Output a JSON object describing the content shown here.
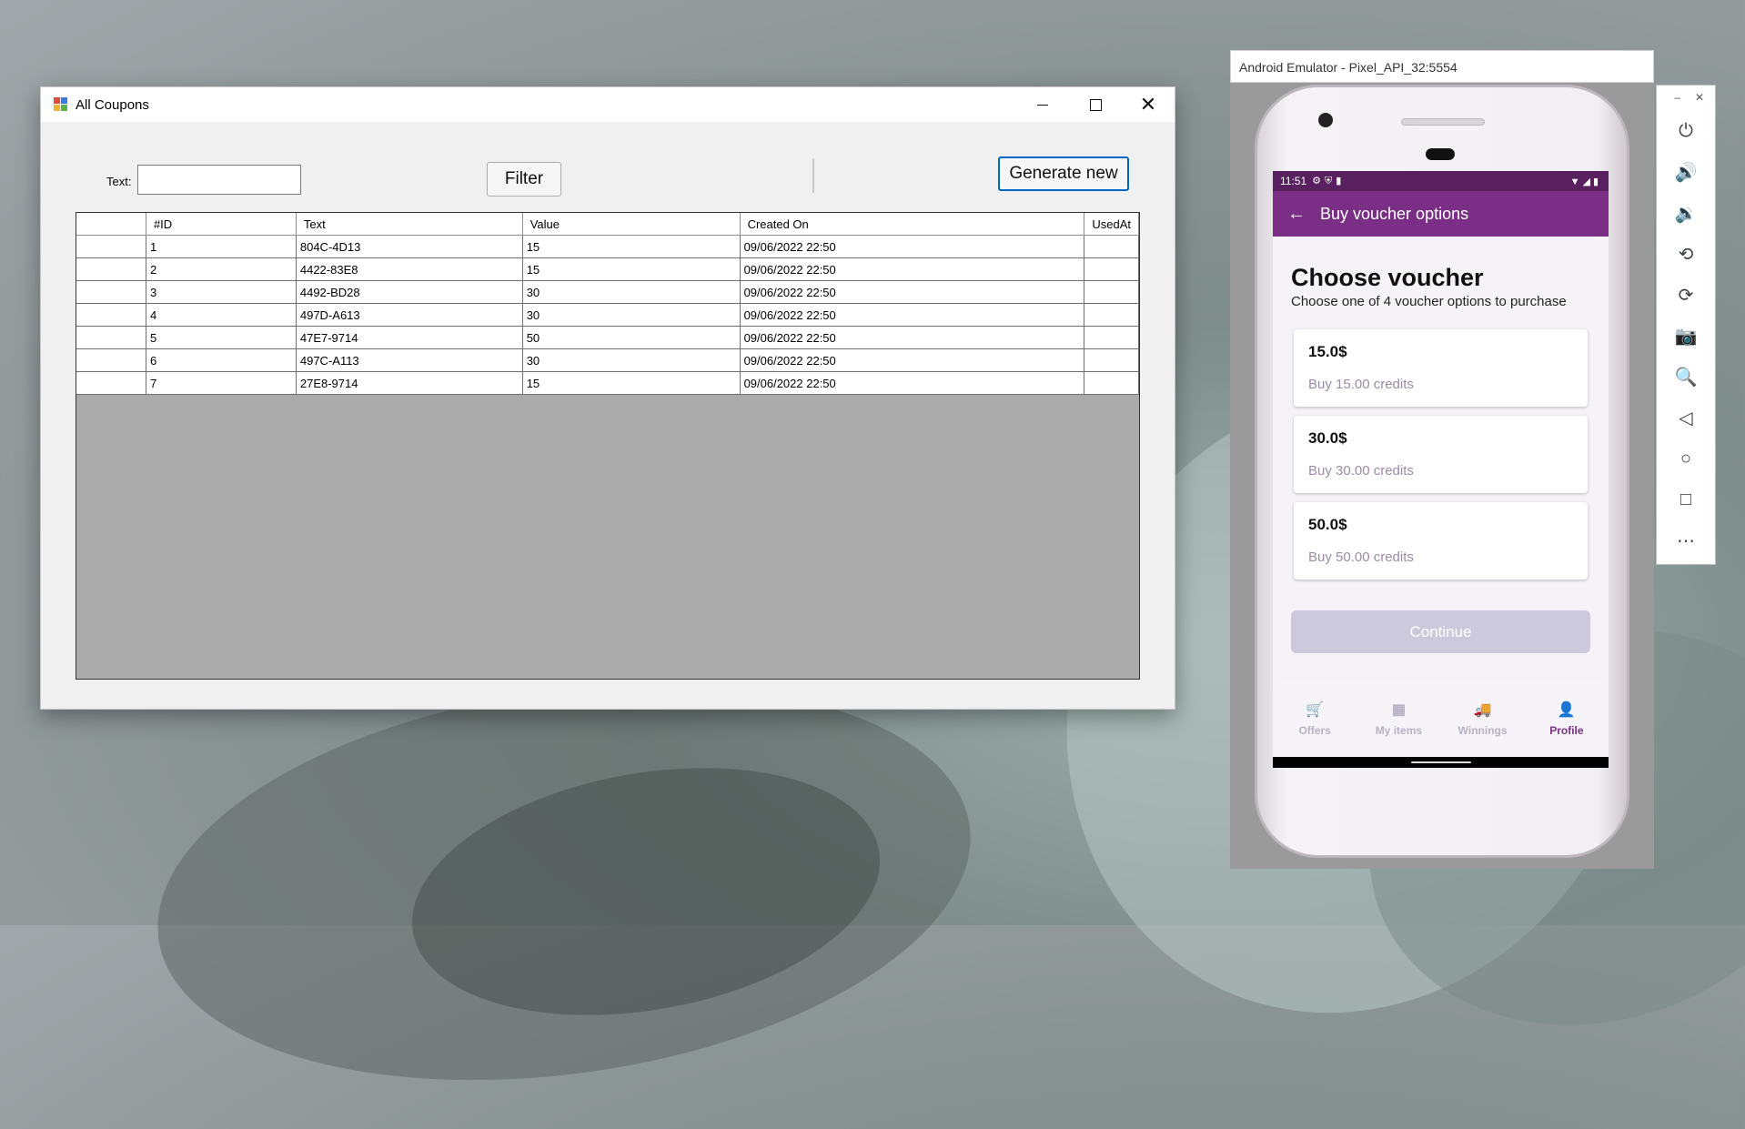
{
  "coupons_window": {
    "title": "All Coupons",
    "text_label": "Text:",
    "text_value": "",
    "filter_button": "Filter",
    "generate_button": "Generate new",
    "columns": [
      "#ID",
      "Text",
      "Value",
      "Created On",
      "UsedAt"
    ],
    "rows": [
      {
        "id": "1",
        "text": "804C-4D13",
        "value": "15",
        "created": "09/06/2022 22:50",
        "used": ""
      },
      {
        "id": "2",
        "text": "4422-83E8",
        "value": "15",
        "created": "09/06/2022 22:50",
        "used": ""
      },
      {
        "id": "3",
        "text": "4492-BD28",
        "value": "30",
        "created": "09/06/2022 22:50",
        "used": ""
      },
      {
        "id": "4",
        "text": "497D-A613",
        "value": "30",
        "created": "09/06/2022 22:50",
        "used": ""
      },
      {
        "id": "5",
        "text": "47E7-9714",
        "value": "50",
        "created": "09/06/2022 22:50",
        "used": ""
      },
      {
        "id": "6",
        "text": "497C-A113",
        "value": "30",
        "created": "09/06/2022 22:50",
        "used": ""
      },
      {
        "id": "7",
        "text": "27E8-9714",
        "value": "15",
        "created": "09/06/2022 22:50",
        "used": ""
      }
    ]
  },
  "emulator": {
    "title": "Android Emulator - Pixel_API_32:5554",
    "status_time": "11:51",
    "appbar_title": "Buy voucher options",
    "heading": "Choose voucher",
    "subheading": "Choose one of 4 voucher options to purchase",
    "vouchers": [
      {
        "title": "15.0$",
        "subtitle": "Buy 15.00 credits"
      },
      {
        "title": "30.0$",
        "subtitle": "Buy 30.00 credits"
      },
      {
        "title": "50.0$",
        "subtitle": "Buy 50.00 credits"
      }
    ],
    "continue_button": "Continue",
    "nav": [
      {
        "label": "Offers",
        "icon": "cart-icon"
      },
      {
        "label": "My items",
        "icon": "grid-icon"
      },
      {
        "label": "Winnings",
        "icon": "truck-icon"
      },
      {
        "label": "Profile",
        "icon": "person-icon",
        "active": true
      }
    ],
    "side_controls": [
      "power-icon",
      "volume-up-icon",
      "volume-down-icon",
      "rotate-left-icon",
      "rotate-right-icon",
      "camera-icon",
      "zoom-icon",
      "back-icon",
      "home-icon",
      "overview-icon",
      "more-icon"
    ]
  },
  "colors": {
    "app_primary": "#7b2e86",
    "status_bar": "#59205f",
    "accent_border": "#0067c0"
  }
}
